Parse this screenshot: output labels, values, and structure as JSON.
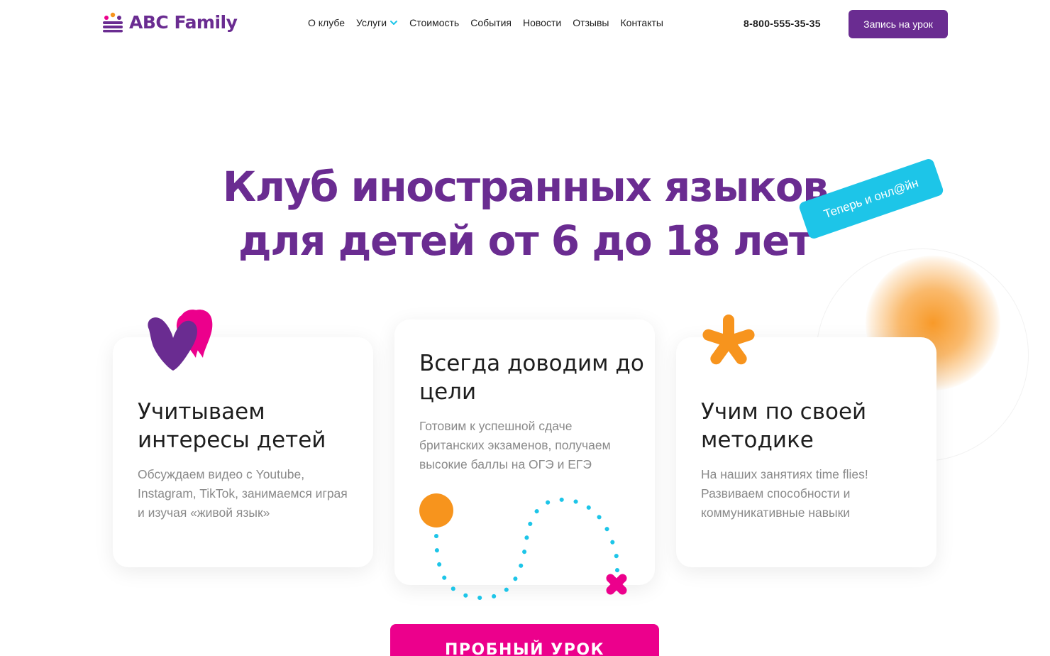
{
  "header": {
    "logo_text": "ABC Family",
    "nav": [
      {
        "label": "О клубе",
        "has_dropdown": false
      },
      {
        "label": "Услуги",
        "has_dropdown": true
      },
      {
        "label": "Стоимость",
        "has_dropdown": false
      },
      {
        "label": "События",
        "has_dropdown": false
      },
      {
        "label": "Новости",
        "has_dropdown": false
      },
      {
        "label": "Отзывы",
        "has_dropdown": false
      },
      {
        "label": "Контакты",
        "has_dropdown": false
      }
    ],
    "phone": "8-800-555-35-35",
    "signup_button": "Запись на урок"
  },
  "hero": {
    "title_line1": "Клуб иностранных языков",
    "title_line2": "для детей от 6 до 18 лет",
    "badge": "Теперь и онл@йн"
  },
  "cards": [
    {
      "icon": "hearts-icon",
      "title": "Учитываем интересы детей",
      "text": "Обсуждаем видео с Youtube, Instagram, TikTok, занимаемся играя и изучая «живой язык»"
    },
    {
      "icon": "dotted-path-icon",
      "title": "Всегда доводим до цели",
      "text": "Готовим к успешной сдаче британских экзаменов, получаем высокие баллы на ОГЭ и ЕГЭ"
    },
    {
      "icon": "asterisk-flower-icon",
      "title": "Учим по своей методике",
      "text": "На наших занятиях time flies! Развиваем способности и коммуникативные навыки"
    }
  ],
  "cta": {
    "label": "ПРОБНЫЙ УРОК"
  },
  "colors": {
    "brand_purple": "#6a2c91",
    "accent_pink": "#ec008c",
    "accent_cyan": "#1dc5e8",
    "accent_orange": "#f7941d"
  }
}
